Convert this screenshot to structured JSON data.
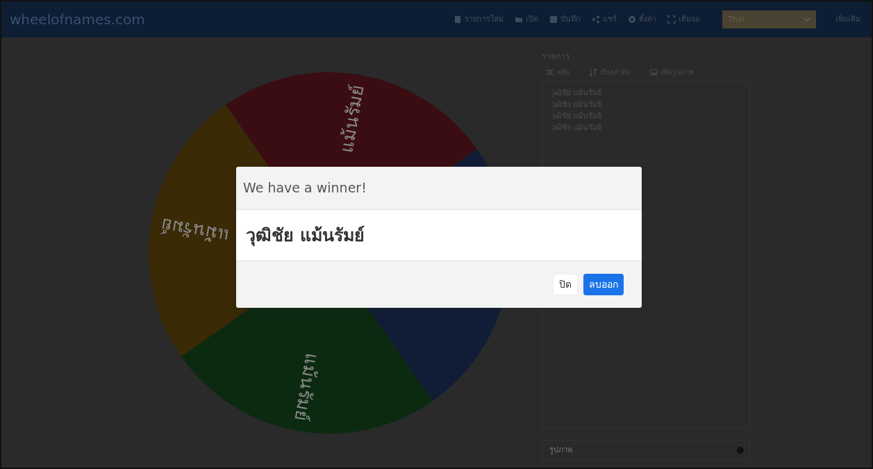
{
  "navbar": {
    "brand": "wheelofnames.com",
    "items": [
      {
        "kind": "new",
        "label": "รายการใหม่"
      },
      {
        "kind": "open",
        "label": "เปิด"
      },
      {
        "kind": "save",
        "label": "บันทึก"
      },
      {
        "kind": "share",
        "label": "แชร์"
      },
      {
        "kind": "settings",
        "label": "ตั้งค่า"
      },
      {
        "kind": "fullscreen",
        "label": "เต็มจอ"
      }
    ],
    "language": "Thai",
    "more": "เพิ่มเติม"
  },
  "wheel": {
    "segments": [
      {
        "label": "แม้นรัมย์",
        "color": "#3a0d12"
      },
      {
        "color": "#111d36"
      },
      {
        "label": "แม้นรัมย์",
        "color": "#0b2a10"
      },
      {
        "label": "แม้นรัมย์",
        "color": "#3a2a06"
      }
    ]
  },
  "panel": {
    "title": "รายการ",
    "actions": [
      {
        "kind": "shuffle",
        "label": "สลับ"
      },
      {
        "kind": "sort",
        "label": "เรียงลำดับ"
      },
      {
        "kind": "image",
        "label": "เพิ่มรูปภาพ"
      }
    ],
    "entries": [
      "วุฒิชัย แม้นรัมย์",
      "วุฒิชัย แม้นรัมย์",
      "วุฒิชัย แม้นรัมย์",
      "วุฒิชัย แม้นรัมย์"
    ],
    "input": {
      "placeholder": "รูปภาพ"
    }
  },
  "modal": {
    "title": "We have a winner!",
    "winner": "วุฒิชัย  แม้นรัมย์",
    "buttons": [
      {
        "kind": "secondary",
        "label": "ปิด"
      },
      {
        "kind": "primary",
        "label": "ลบออก"
      }
    ]
  }
}
